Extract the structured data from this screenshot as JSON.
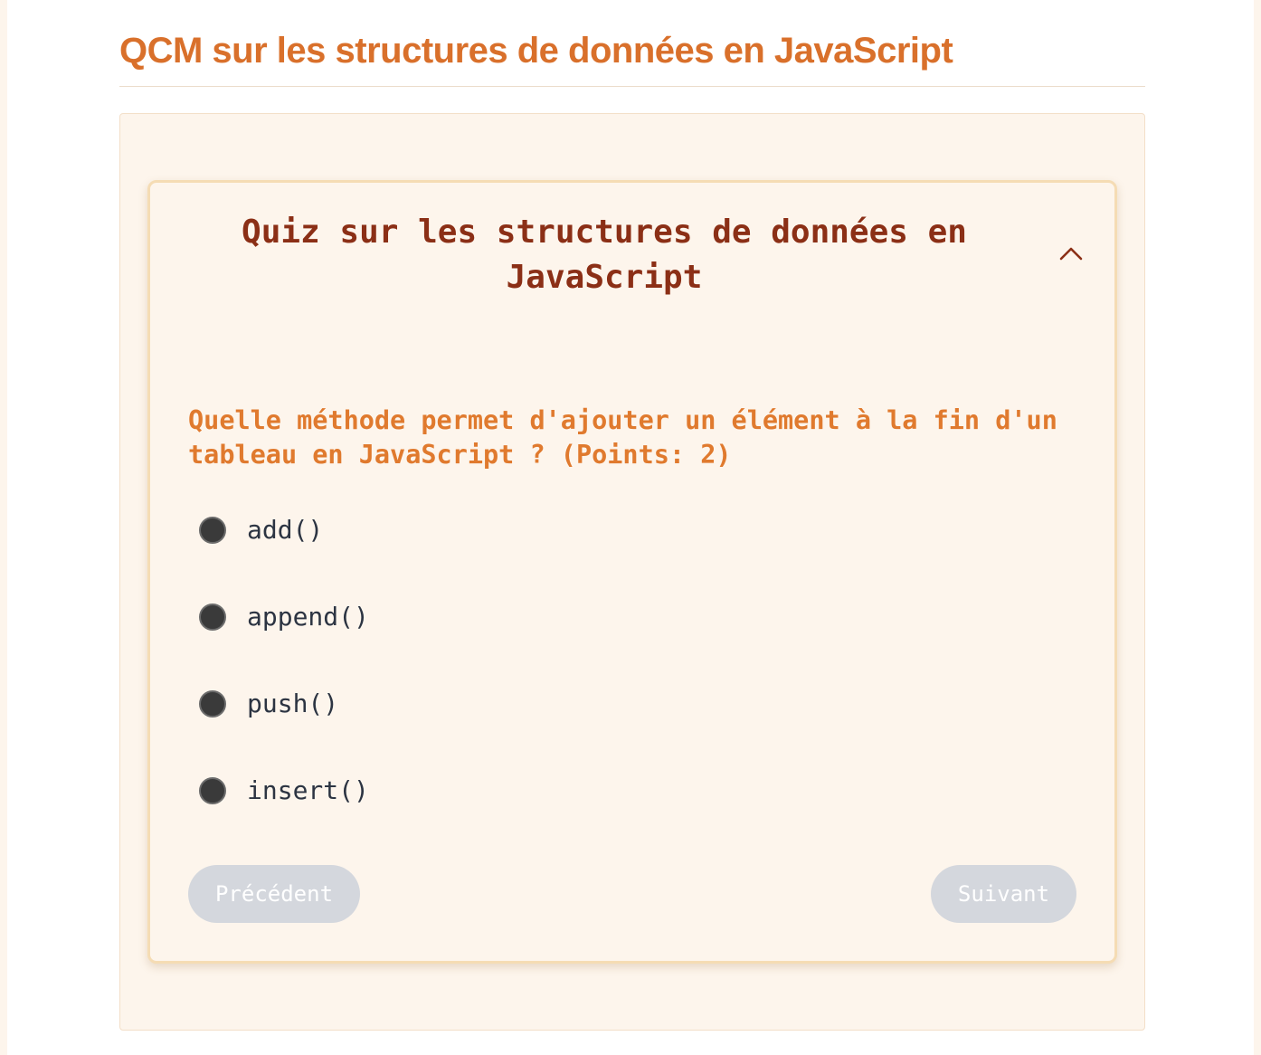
{
  "page": {
    "title": "QCM sur les structures de données en JavaScript"
  },
  "quiz": {
    "title": "Quiz sur les structures de données en JavaScript",
    "toggle_icon": "chevron-up-icon",
    "question": "Quelle méthode permet d'ajouter un élément à la fin d'un tableau en JavaScript ? (Points: 2)",
    "options": [
      {
        "label": "add()"
      },
      {
        "label": "append()"
      },
      {
        "label": "push()"
      },
      {
        "label": "insert()"
      }
    ],
    "nav": {
      "prev_label": "Précédent",
      "next_label": "Suivant"
    }
  },
  "colors": {
    "heading_orange": "#d9702b",
    "question_orange": "#e07a2e",
    "quiz_title_brown": "#8b2f16",
    "panel_bg": "#fdf5ec",
    "card_border": "#f5dcb4",
    "button_disabled": "#d4d7dd"
  }
}
